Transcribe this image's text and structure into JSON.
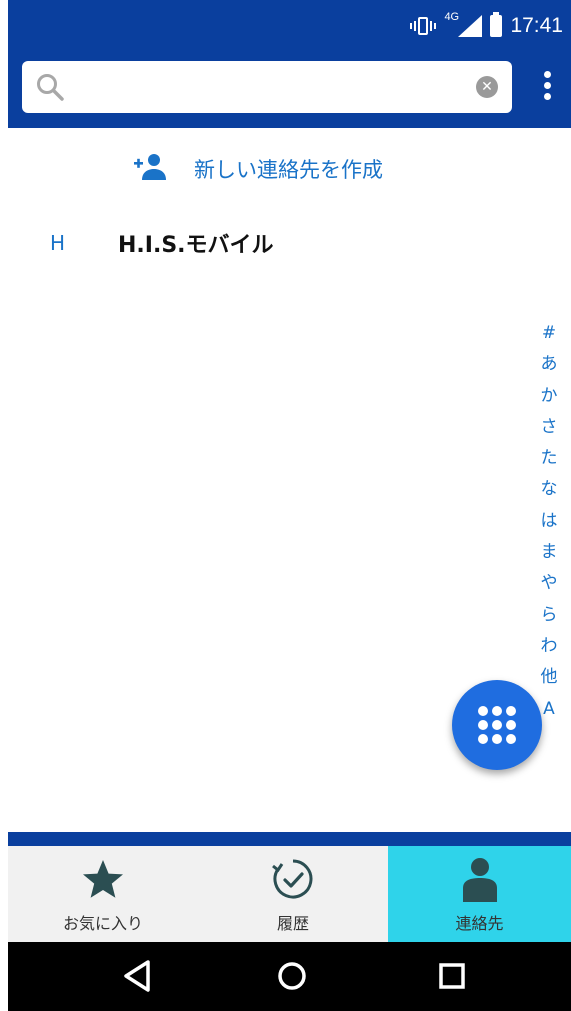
{
  "status_bar": {
    "network_label": "4G",
    "time": "17:41"
  },
  "search": {
    "placeholder": "",
    "value": ""
  },
  "contacts": {
    "create_label": "新しい連絡先を作成",
    "items": [
      {
        "section": "H",
        "name": "H.I.S.モバイル"
      }
    ]
  },
  "index_bar": [
    "#",
    "あ",
    "か",
    "さ",
    "た",
    "な",
    "は",
    "ま",
    "や",
    "ら",
    "わ",
    "他",
    "A"
  ],
  "bottom_nav": {
    "tabs": [
      {
        "label": "お気に入り",
        "icon": "star-icon",
        "active": false
      },
      {
        "label": "履歴",
        "icon": "clock-icon",
        "active": false
      },
      {
        "label": "連絡先",
        "icon": "person-icon",
        "active": true
      }
    ]
  },
  "colors": {
    "primary": "#0a3f9e",
    "accent": "#1a73c8",
    "fab": "#1f6de0",
    "active_tab": "#2fd3ea"
  }
}
